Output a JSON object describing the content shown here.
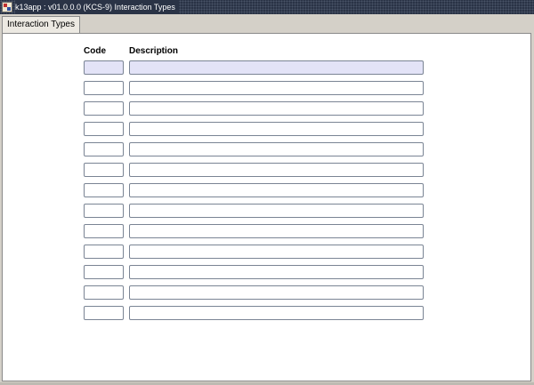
{
  "window": {
    "title": "k13app : v01.0.0.0 (KCS-9) Interaction Types"
  },
  "tabs": [
    {
      "label": "Interaction Types"
    }
  ],
  "table": {
    "columns": {
      "code": "Code",
      "description": "Description"
    },
    "rows": [
      {
        "code": "",
        "description": ""
      },
      {
        "code": "",
        "description": ""
      },
      {
        "code": "",
        "description": ""
      },
      {
        "code": "",
        "description": ""
      },
      {
        "code": "",
        "description": ""
      },
      {
        "code": "",
        "description": ""
      },
      {
        "code": "",
        "description": ""
      },
      {
        "code": "",
        "description": ""
      },
      {
        "code": "",
        "description": ""
      },
      {
        "code": "",
        "description": ""
      },
      {
        "code": "",
        "description": ""
      },
      {
        "code": "",
        "description": ""
      },
      {
        "code": "",
        "description": ""
      }
    ]
  },
  "colors": {
    "titlebar": "#2a3346",
    "active_row": "#e3e3f7",
    "field_border": "#7a8494"
  },
  "icons": {
    "app": "app-window-icon"
  }
}
